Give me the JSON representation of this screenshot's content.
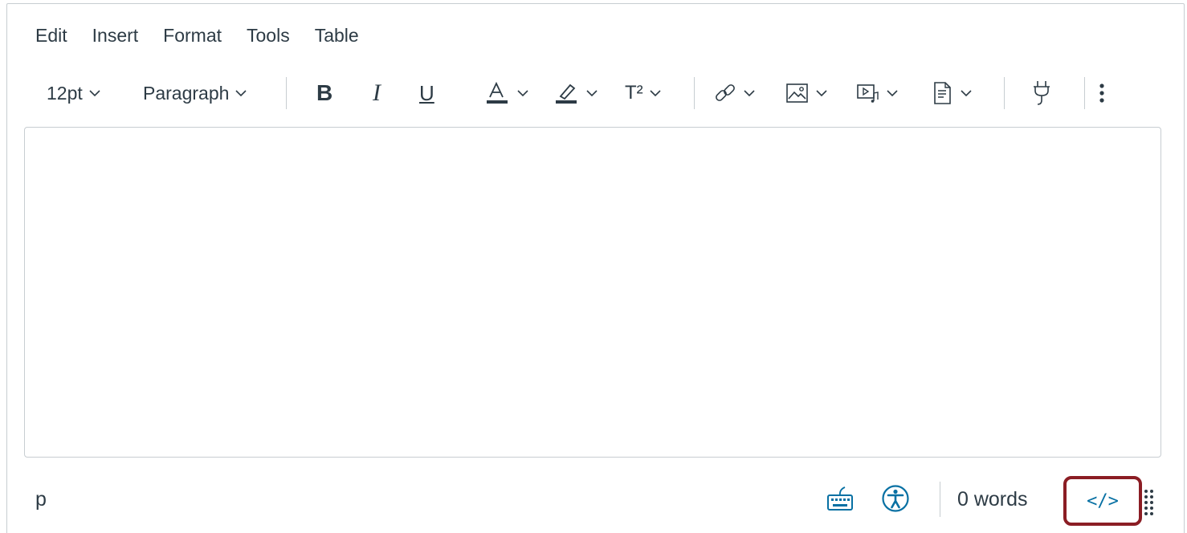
{
  "menubar": {
    "items": [
      {
        "label": "Edit"
      },
      {
        "label": "Insert"
      },
      {
        "label": "Format"
      },
      {
        "label": "Tools"
      },
      {
        "label": "Table"
      }
    ]
  },
  "toolbar": {
    "font_size": "12pt",
    "block_format": "Paragraph",
    "bold_label": "B",
    "italic_label": "I",
    "underline_label": "U",
    "superscript_label": "T²",
    "more_icon": "more-vertical-icon"
  },
  "statusbar": {
    "path": "p",
    "word_count": "0 words",
    "html_toggle_label": "</>"
  },
  "colors": {
    "accent_blue": "#0770a3",
    "highlight_border": "#8b1d24",
    "text": "#2d3b45",
    "border": "#c7cdd1"
  }
}
